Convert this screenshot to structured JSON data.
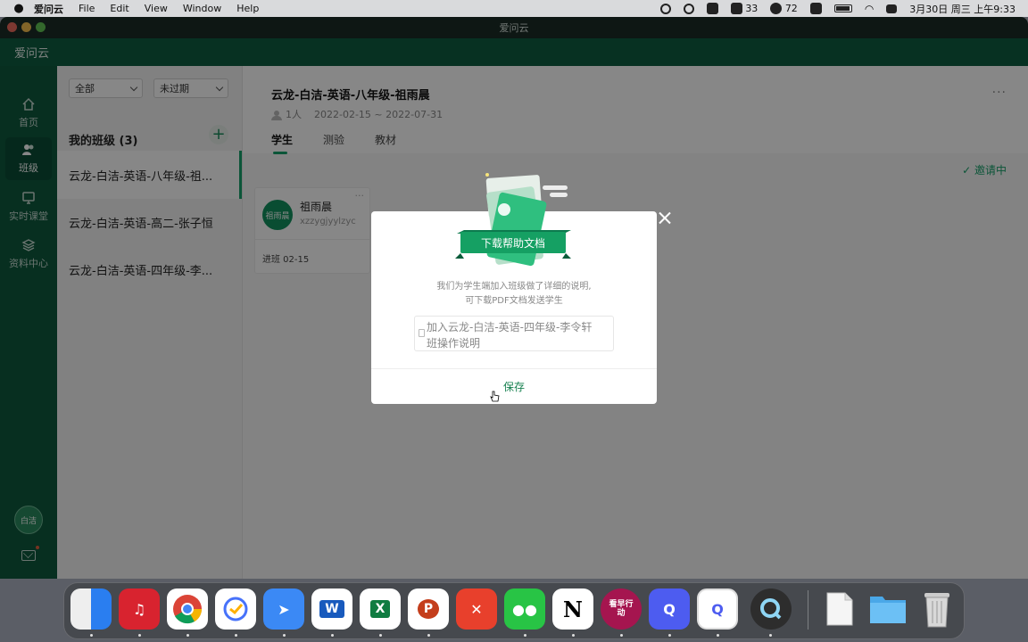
{
  "menubar": {
    "app_name": "爱问云",
    "items": [
      "File",
      "Edit",
      "View",
      "Window",
      "Help"
    ],
    "wechat_count": "33",
    "badge_72": "72",
    "datetime": "3月30日 周三 上午9:33"
  },
  "window": {
    "title": "爱问云",
    "app_label": "爱问云"
  },
  "nav": {
    "items": [
      {
        "label": "首页"
      },
      {
        "label": "班级"
      },
      {
        "label": "实时课堂"
      },
      {
        "label": "资料中心"
      }
    ],
    "user_avatar": "白洁"
  },
  "filters": {
    "scope": "全部",
    "status": "未过期"
  },
  "class_list": {
    "heading": "我的班级 (3)",
    "add": "+",
    "items": [
      "云龙-白洁-英语-八年级-祖...",
      "云龙-白洁-英语-高二-张子恒",
      "云龙-白洁-英语-四年级-李..."
    ]
  },
  "class_detail": {
    "title": "云龙-白洁-英语-八年级-祖雨晨",
    "member_count": "1人",
    "date_range": "2022-02-15 ~ 2022-07-31",
    "more": "···",
    "tabs": [
      "学生",
      "测验",
      "教材"
    ],
    "invite_status": "✓ 邀请中",
    "student": {
      "avatar": "祖雨晨",
      "name": "祖雨晨",
      "id": "xzzygjyylzyc",
      "joined": "进班  02-15",
      "more": "···"
    }
  },
  "modal": {
    "banner": "下载帮助文档",
    "description_line1": "我们为学生端加入班级做了详细的说明,",
    "description_line2": "可下载PDF文档发送学生",
    "file_name_line1": "加入云龙-白洁-英语-四年级-李令轩",
    "file_name_line2": "班操作说明",
    "save_label": "保存"
  },
  "dock": {
    "apps": [
      "finder",
      "netease-music",
      "chrome",
      "ticktick",
      "lark",
      "word",
      "excel",
      "powerpoint",
      "xmind",
      "wechat",
      "notion",
      "kanzao",
      "iwenyun",
      "iwenyun-alt",
      "quicktime",
      "document",
      "folder",
      "trash"
    ],
    "kanzao_label": "看早行动",
    "word_label": "W",
    "excel_label": "X",
    "ppt_label": "P",
    "notion_label": "N"
  },
  "colors": {
    "brand_green": "#0f5d41",
    "accent_green": "#16a06a"
  }
}
